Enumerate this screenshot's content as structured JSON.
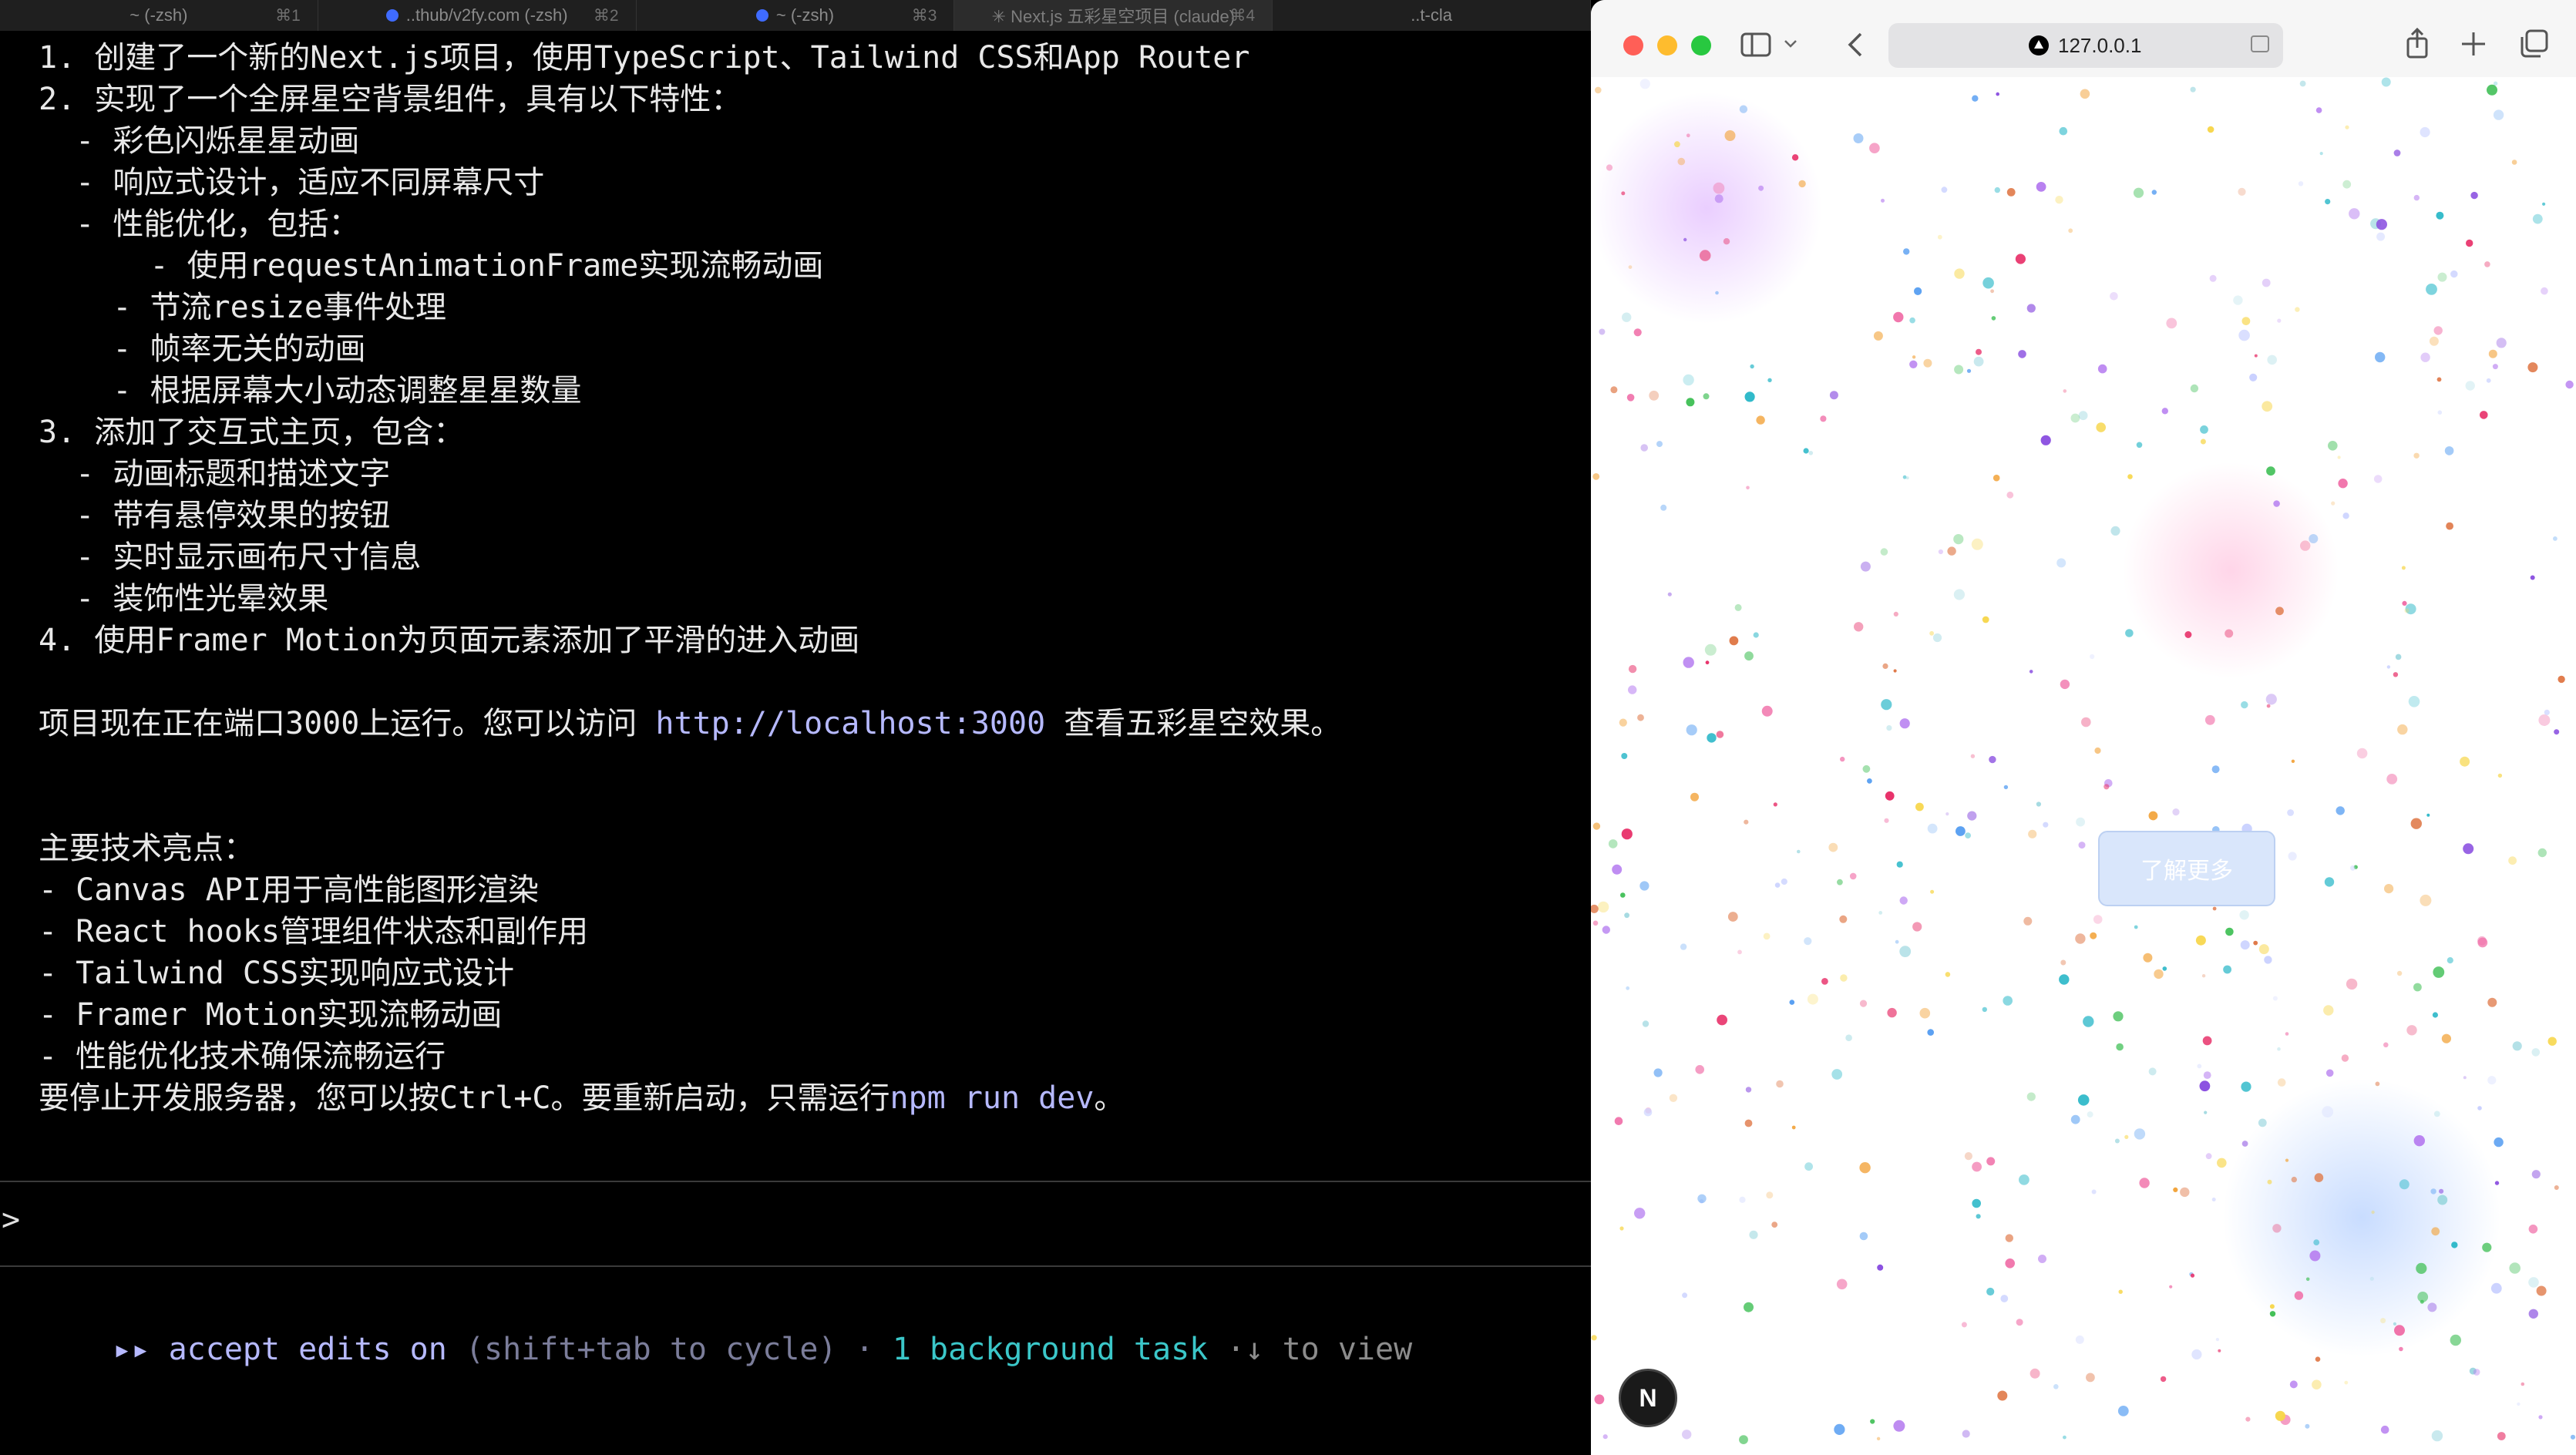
{
  "terminal_tabs": [
    {
      "title": "~ (-zsh)",
      "shortcut": "⌘1",
      "dot": false,
      "active": false
    },
    {
      "title": "..thub/v2fy.com (-zsh)",
      "shortcut": "⌘2",
      "dot": true,
      "active": false
    },
    {
      "title": "~ (-zsh)",
      "shortcut": "⌘3",
      "dot": true,
      "active": false
    },
    {
      "title": "✳ Next.js 五彩星空项目 (claude)",
      "shortcut": "⌘4",
      "dot": false,
      "active": true
    },
    {
      "title": "..t-cla",
      "shortcut": "",
      "dot": false,
      "active": false
    }
  ],
  "terminal": {
    "lines": [
      "1. 创建了一个新的Next.js项目，使用TypeScript、Tailwind CSS和App Router",
      "2. 实现了一个全屏星空背景组件，具有以下特性：",
      "  - 彩色闪烁星星动画",
      "  - 响应式设计，适应不同屏幕尺寸",
      "  - 性能优化，包括：",
      "      - 使用requestAnimationFrame实现流畅动画",
      "    - 节流resize事件处理",
      "    - 帧率无关的动画",
      "    - 根据屏幕大小动态调整星星数量",
      "3. 添加了交互式主页，包含：",
      "  - 动画标题和描述文字",
      "  - 带有悬停效果的按钮",
      "  - 实时显示画布尺寸信息",
      "  - 装饰性光晕效果",
      "4. 使用Framer Motion为页面元素添加了平滑的进入动画",
      "",
      "",
      "",
      "主要技术亮点：",
      "- Canvas API用于高性能图形渲染",
      "- React hooks管理组件状态和副作用",
      "- Tailwind CSS实现响应式设计",
      "- Framer Motion实现流畅动画",
      "- 性能优化技术确保流畅运行",
      "",
      ""
    ],
    "running_line": {
      "before": "项目现在正在端口3000上运行。您可以访问 ",
      "url": "http://localhost:3000",
      "after": " 查看五彩星空效果。"
    },
    "stop_line": {
      "before": "要停止开发服务器，您可以按Ctrl+C。要重新启动，只需运行",
      "cmd": "npm run dev",
      "after": "。"
    },
    "prompt": ">",
    "status": {
      "arrows": "▸▸",
      "accept": "accept edits on",
      "hint": "(shift+tab to cycle)",
      "sep": "·",
      "background": "1 background task",
      "view": "·↓ to view"
    }
  },
  "browser": {
    "url": "127.0.0.1",
    "icons": {
      "sidebar": "sidebar-icon",
      "chevron": "chevron-down-icon",
      "back": "back-arrow-icon",
      "share": "share-icon",
      "newtab": "plus-icon",
      "tabs": "tab-overview-icon",
      "reader": "reader-icon"
    },
    "button_label": "了解更多",
    "badge_label": "N"
  },
  "colors": {
    "accent_text": "#b6b9ff",
    "teal": "#3bc7c9",
    "button_bg": "#d9e6fb"
  }
}
